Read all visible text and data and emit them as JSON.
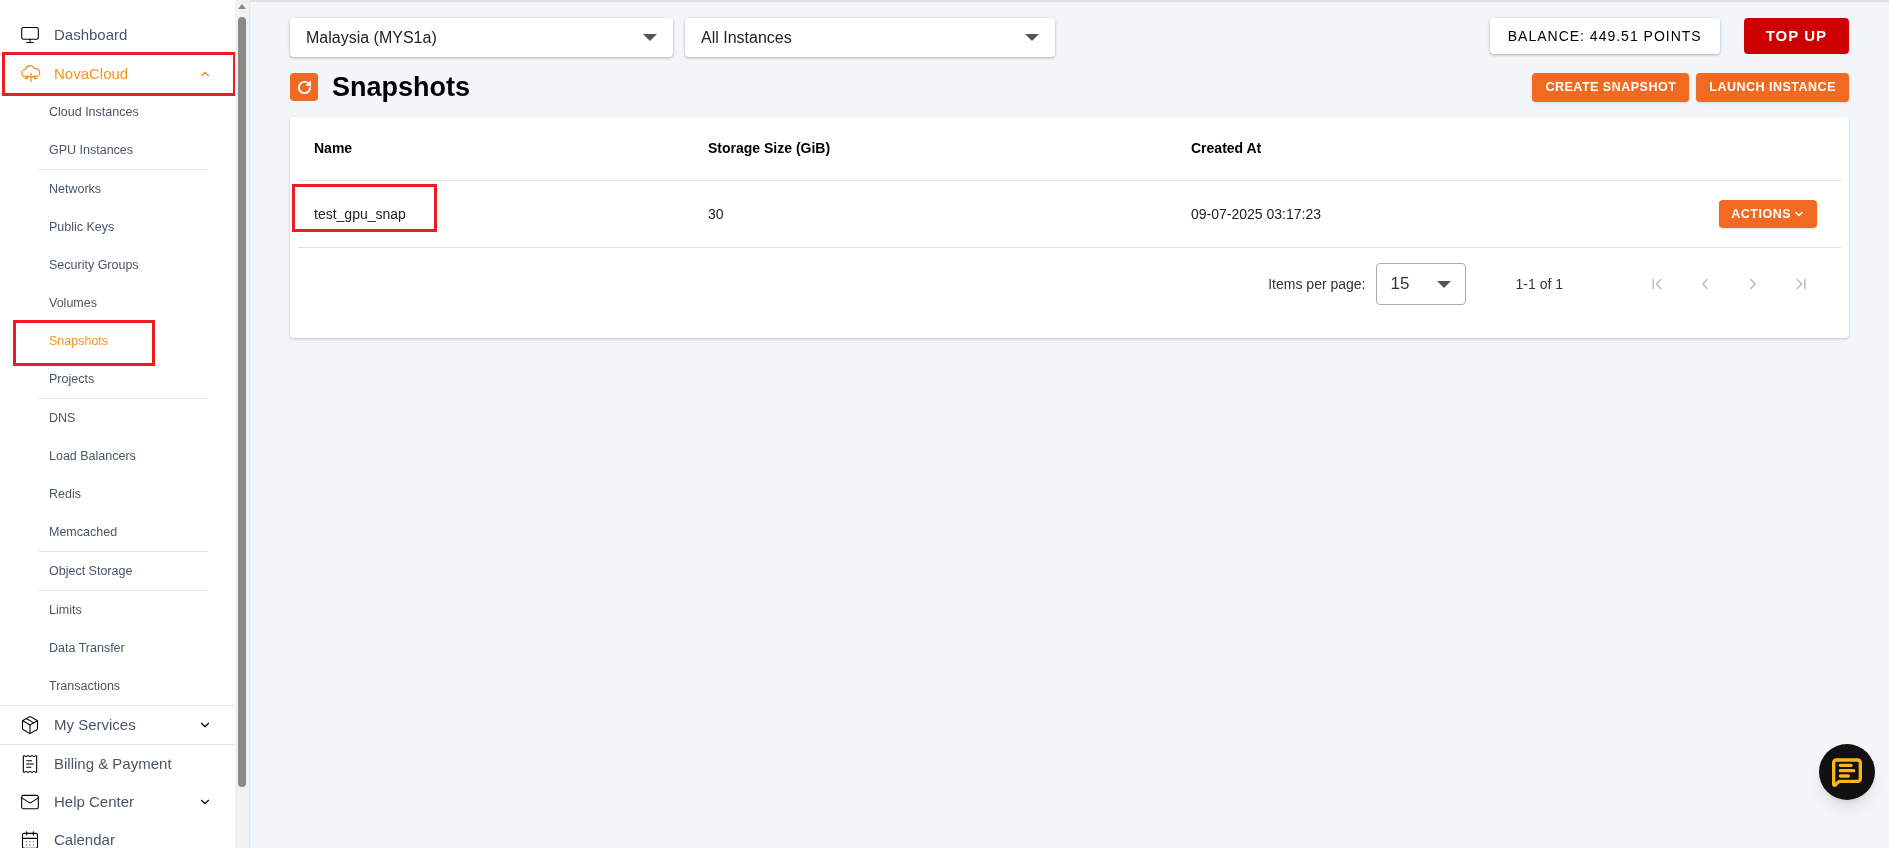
{
  "sidebar": {
    "items": [
      {
        "label": "Dashboard",
        "selected": false,
        "highlighted": false
      },
      {
        "label": "NovaCloud",
        "selected": true,
        "highlighted": true,
        "expanded": true,
        "children": [
          [
            {
              "label": "Cloud Instances",
              "selected": false,
              "highlighted": false
            },
            {
              "label": "GPU Instances",
              "selected": false,
              "highlighted": false
            }
          ],
          [
            {
              "label": "Networks",
              "selected": false,
              "highlighted": false
            },
            {
              "label": "Public Keys",
              "selected": false,
              "highlighted": false
            },
            {
              "label": "Security Groups",
              "selected": false,
              "highlighted": false
            },
            {
              "label": "Volumes",
              "selected": false,
              "highlighted": false
            },
            {
              "label": "Snapshots",
              "selected": true,
              "highlighted": true
            },
            {
              "label": "Projects",
              "selected": false,
              "highlighted": false
            }
          ],
          [
            {
              "label": "DNS",
              "selected": false,
              "highlighted": false
            },
            {
              "label": "Load Balancers",
              "selected": false,
              "highlighted": false
            },
            {
              "label": "Redis",
              "selected": false,
              "highlighted": false
            },
            {
              "label": "Memcached",
              "selected": false,
              "highlighted": false
            }
          ],
          [
            {
              "label": "Object Storage",
              "selected": false,
              "highlighted": false
            }
          ],
          [
            {
              "label": "Limits",
              "selected": false,
              "highlighted": false
            },
            {
              "label": "Data Transfer",
              "selected": false,
              "highlighted": false
            },
            {
              "label": "Transactions",
              "selected": false,
              "highlighted": false
            }
          ]
        ]
      },
      {
        "label": "My Services",
        "selected": false,
        "highlighted": false,
        "expanded": false
      },
      {
        "label": "Billing & Payment",
        "selected": false,
        "highlighted": false
      },
      {
        "label": "Help Center",
        "selected": false,
        "highlighted": false,
        "expanded": false
      },
      {
        "label": "Calendar",
        "selected": false,
        "highlighted": false
      }
    ]
  },
  "filters": [
    {
      "value": "Malaysia (MYS1a)"
    },
    {
      "value": "All Instances"
    }
  ],
  "balance": "BALANCE: 449.51 POINTS",
  "top_up": "TOP UP",
  "page_title": "Snapshots",
  "actions": [
    "CREATE SNAPSHOT",
    "LAUNCH INSTANCE"
  ],
  "table": {
    "columns": [
      "Name",
      "Storage Size (GiB)",
      "Created At"
    ],
    "rows": [
      {
        "name": "test_gpu_snap",
        "name_highlighted": true,
        "size": "30",
        "created": "09-07-2025 03:17:23",
        "action": "ACTIONS"
      }
    ]
  },
  "pagination": {
    "label": "Items per page:",
    "page_size": "15",
    "range": "1-1 of 1"
  }
}
